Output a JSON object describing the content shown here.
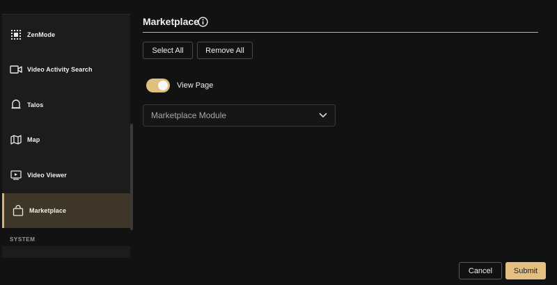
{
  "sidebar": {
    "items": [
      {
        "label": "ZenMode",
        "icon": "zenmode-icon"
      },
      {
        "label": "Video Activity Search",
        "icon": "video-camera-icon"
      },
      {
        "label": "Talos",
        "icon": "bell-icon"
      },
      {
        "label": "Map",
        "icon": "map-icon"
      },
      {
        "label": "Video Viewer",
        "icon": "video-player-icon"
      },
      {
        "label": "Marketplace",
        "icon": "shopping-bag-icon",
        "active": true
      }
    ],
    "section_label": "SYSTEM"
  },
  "main": {
    "title": "Marketplace",
    "select_all_label": "Select All",
    "remove_all_label": "Remove All",
    "toggle": {
      "label": "View Page",
      "on": true
    },
    "select": {
      "value": "Marketplace Module"
    }
  },
  "footer": {
    "cancel_label": "Cancel",
    "submit_label": "Submit"
  },
  "colors": {
    "accent": "#e3c07f",
    "active_bg": "#3f362a",
    "background": "#121212"
  }
}
